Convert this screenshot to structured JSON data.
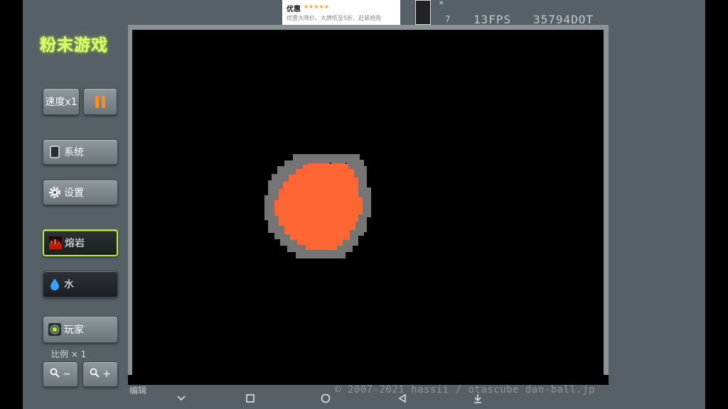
{
  "logo": "粉末游戏",
  "controls": {
    "speed_label": "速度x1",
    "system_label": "系统",
    "settings_label": "设置",
    "scale_label": "比例 × 1",
    "zoom_out_label": "−",
    "zoom_in_label": "+"
  },
  "elements": [
    {
      "name": "熔岩",
      "icon": "lava-icon",
      "selected": true
    },
    {
      "name": "水",
      "icon": "water-drop-icon",
      "selected": false
    },
    {
      "name": "玩家",
      "icon": "player-icon",
      "selected": false
    }
  ],
  "status": {
    "fps": "13FPS",
    "dots": "35794DOT",
    "copyright": "© 2007-2021 hassii / otascube dan-ball.jp",
    "edit_label": "编辑",
    "thumb_count": "7"
  },
  "ad": {
    "title": "优惠",
    "stars": "★★★★★",
    "desc": "优惠大降价、大牌低至5折、赶紧抢购"
  },
  "colors": {
    "lava": "#ff6633",
    "stone": "#757575",
    "canvas_bg": "#000000",
    "accent_green": "#b9f23c",
    "panel": "#566066"
  },
  "navbar": [
    "chevron-down-icon",
    "square-icon",
    "circle-icon",
    "back-icon",
    "download-icon"
  ]
}
